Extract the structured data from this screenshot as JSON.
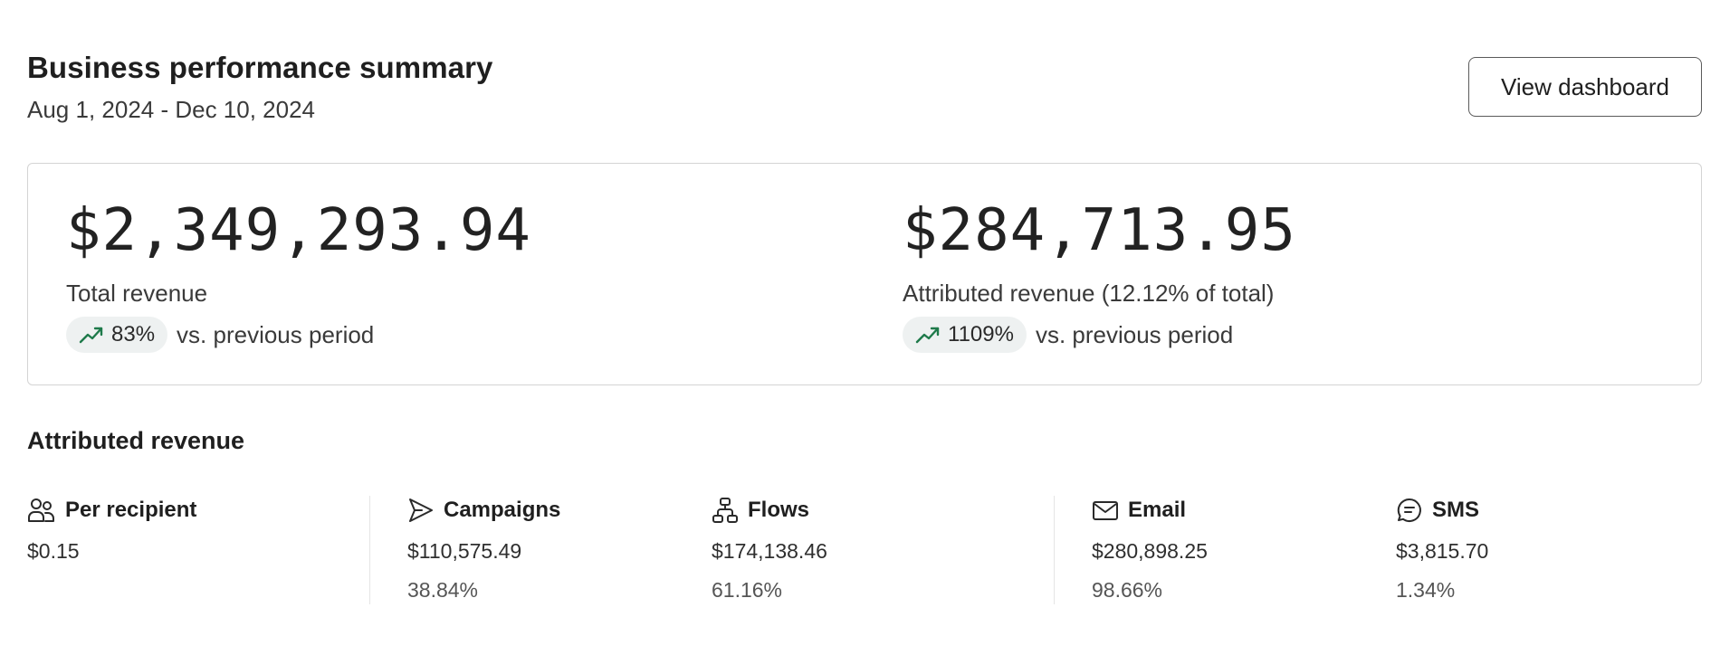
{
  "header": {
    "title": "Business performance summary",
    "date_range": "Aug 1, 2024 - Dec 10, 2024",
    "view_dashboard_label": "View dashboard"
  },
  "summary": {
    "total": {
      "value": "$2,349,293.94",
      "label": "Total revenue",
      "change": "83%",
      "change_suffix": "vs. previous period"
    },
    "attributed": {
      "value": "$284,713.95",
      "label": "Attributed revenue (12.12% of total)",
      "change": "1109%",
      "change_suffix": "vs. previous period"
    }
  },
  "attributed_revenue": {
    "title": "Attributed revenue",
    "stats": [
      {
        "name": "Per recipient",
        "icon": "users-icon",
        "amount": "$0.15",
        "percent": ""
      },
      {
        "name": "Campaigns",
        "icon": "send-icon",
        "amount": "$110,575.49",
        "percent": "38.84%"
      },
      {
        "name": "Flows",
        "icon": "flow-icon",
        "amount": "$174,138.46",
        "percent": "61.16%"
      },
      {
        "name": "Email",
        "icon": "mail-icon",
        "amount": "$280,898.25",
        "percent": "98.66%"
      },
      {
        "name": "SMS",
        "icon": "sms-icon",
        "amount": "$3,815.70",
        "percent": "1.34%"
      }
    ]
  },
  "colors": {
    "trend_up": "#1e7a4a",
    "pill_bg": "#eef1f1",
    "border": "#d4d4d4"
  }
}
